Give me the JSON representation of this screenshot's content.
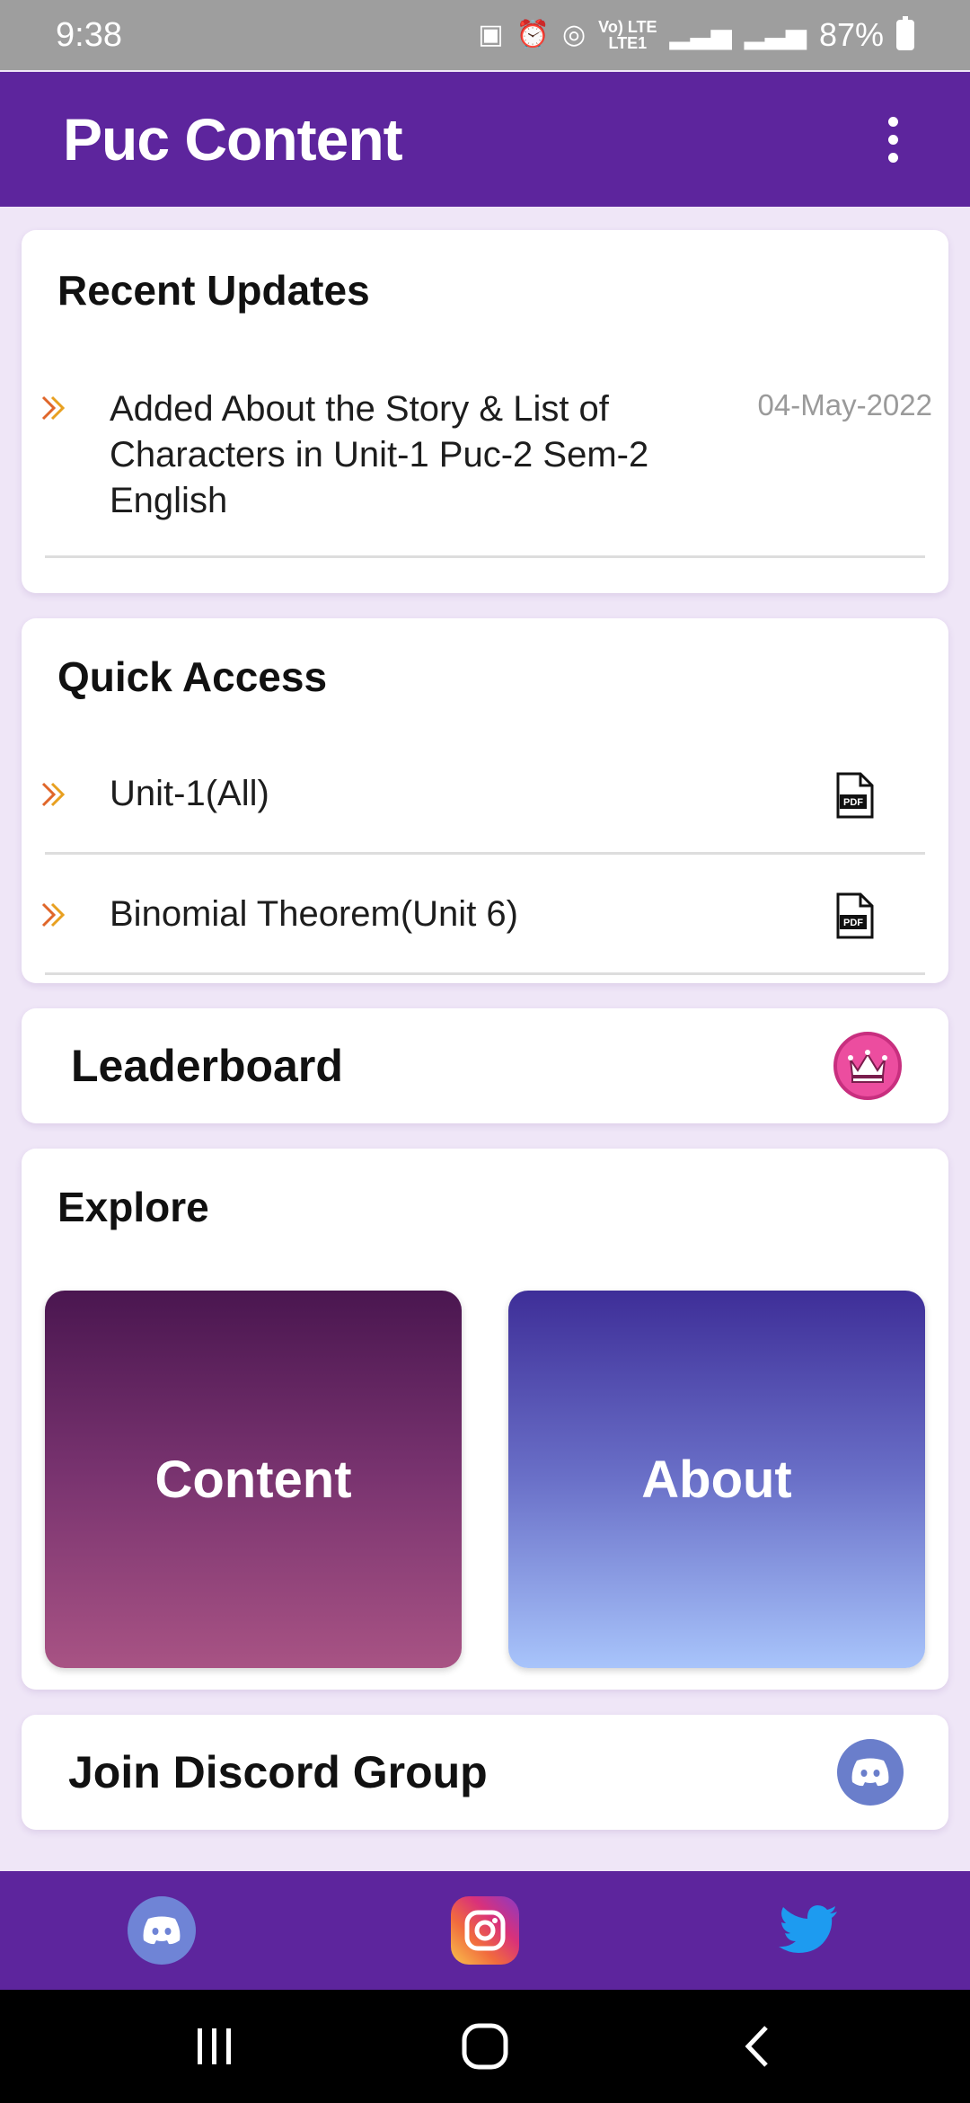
{
  "status_bar": {
    "time": "9:38",
    "battery_percent": "87%",
    "network_label": "Vo) LTE",
    "network_sub": "LTE1",
    "icons": [
      "data-saver-icon",
      "alarm-icon",
      "hotspot-icon",
      "volte-icon",
      "lte-icon",
      "signal-icon",
      "signal-icon",
      "battery-icon"
    ]
  },
  "app_bar": {
    "title": "Puc Content",
    "menu_icon": "more-vert-icon"
  },
  "recent_updates": {
    "title": "Recent Updates",
    "items": [
      {
        "line1": "Added About the Story & List of",
        "line2": "Characters in Unit-1 Puc-2 Sem-2",
        "line3": "English",
        "date": "04-May-2022"
      }
    ]
  },
  "quick_access": {
    "title": "Quick Access",
    "items": [
      {
        "label": "Unit-1(All)",
        "icon": "pdf-icon"
      },
      {
        "label": "Binomial Theorem(Unit 6)",
        "icon": "pdf-icon"
      }
    ]
  },
  "leaderboard": {
    "label": "Leaderboard",
    "icon": "crown-icon"
  },
  "explore": {
    "title": "Explore",
    "tiles": [
      {
        "label": "Content"
      },
      {
        "label": "About"
      }
    ]
  },
  "discord": {
    "label": "Join Discord Group",
    "icon": "discord-icon"
  },
  "social": [
    "discord-icon",
    "instagram-icon",
    "twitter-icon"
  ],
  "colors": {
    "primary": "#5d259d",
    "background": "#efe6f7",
    "chevron": "#e0662a"
  }
}
